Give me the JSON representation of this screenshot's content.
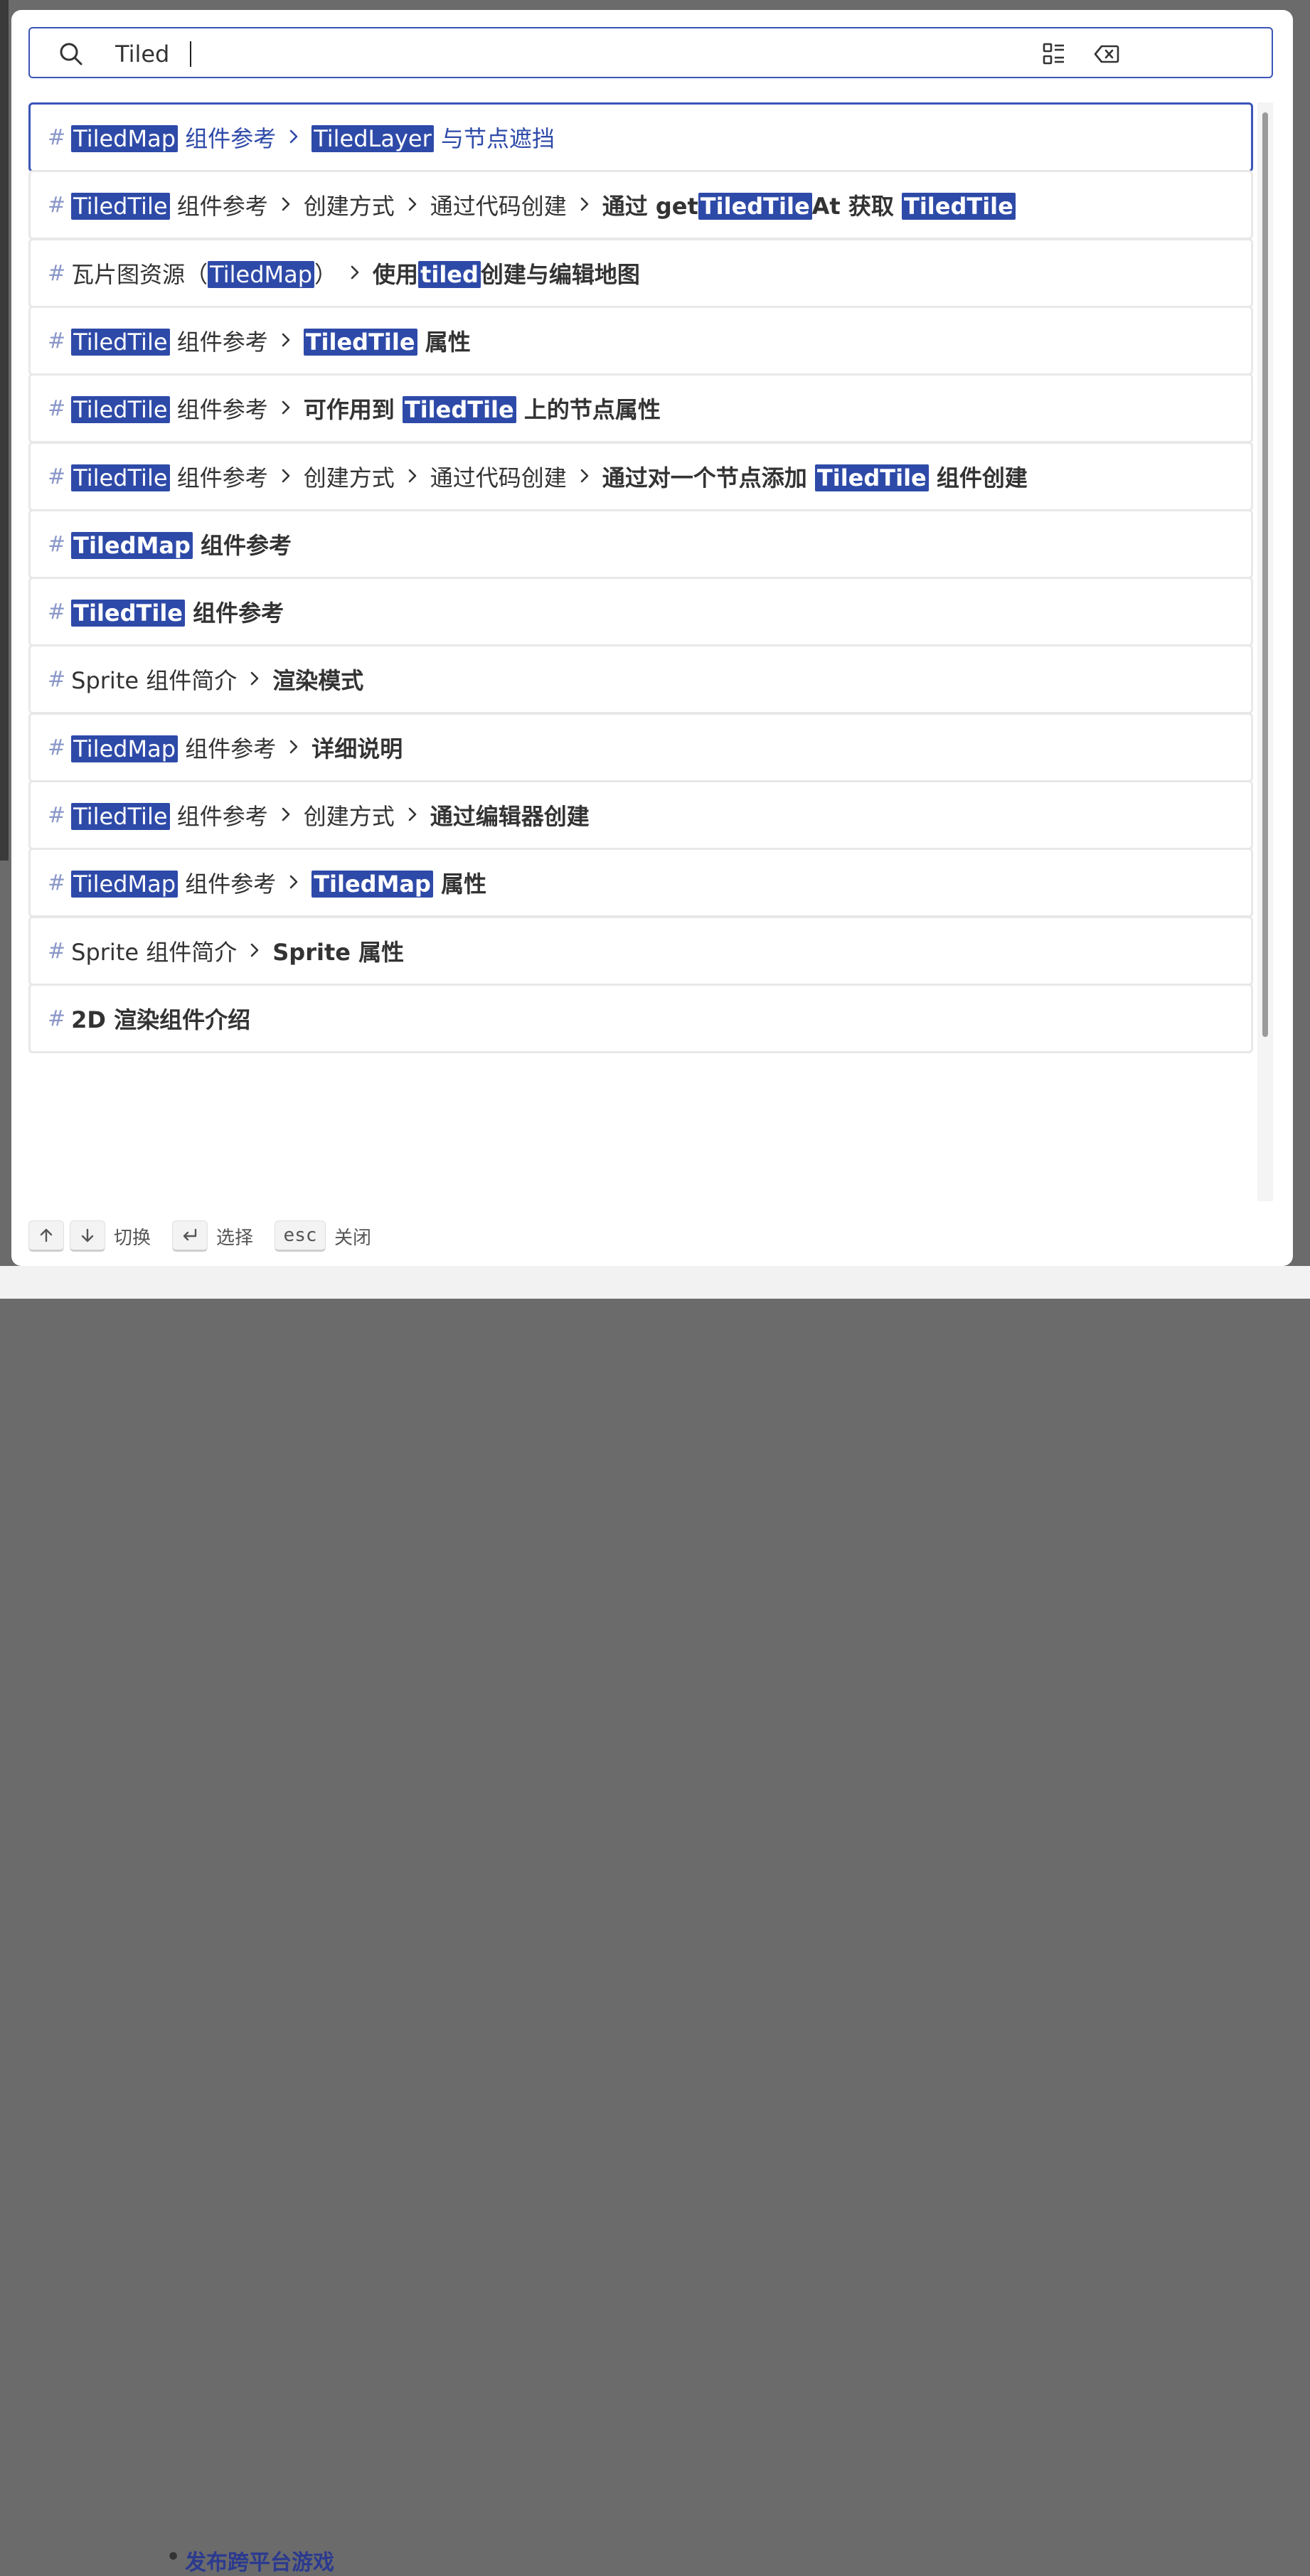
{
  "search": {
    "value": "Tiled",
    "placeholder": ""
  },
  "results": [
    {
      "parts": [
        {
          "segments": [
            {
              "t": "TiledMap",
              "hl": true
            },
            {
              "t": " 组件参考"
            }
          ]
        },
        {
          "segments": [
            {
              "t": "TiledLayer",
              "hl": true
            },
            {
              "t": " 与节点遮挡"
            }
          ]
        }
      ],
      "active": true
    },
    {
      "parts": [
        {
          "segments": [
            {
              "t": "TiledTile",
              "hl": true
            },
            {
              "t": " 组件参考"
            }
          ]
        },
        {
          "segments": [
            {
              "t": "创建方式"
            }
          ]
        },
        {
          "segments": [
            {
              "t": "通过代码创建"
            }
          ]
        },
        {
          "segments": [
            {
              "t": "通过 get"
            },
            {
              "t": "TiledTile",
              "hl": true
            },
            {
              "t": "At 获取 "
            },
            {
              "t": "TiledTile",
              "hl": true
            }
          ]
        }
      ]
    },
    {
      "parts": [
        {
          "segments": [
            {
              "t": "瓦片图资源（"
            },
            {
              "t": "TiledMap",
              "hl": true
            },
            {
              "t": "）"
            }
          ]
        },
        {
          "segments": [
            {
              "t": "使用"
            },
            {
              "t": "tiled",
              "hl": true
            },
            {
              "t": "创建与编辑地图"
            }
          ]
        }
      ]
    },
    {
      "parts": [
        {
          "segments": [
            {
              "t": "TiledTile",
              "hl": true
            },
            {
              "t": " 组件参考"
            }
          ]
        },
        {
          "segments": [
            {
              "t": "TiledTile",
              "hl": true
            },
            {
              "t": " 属性"
            }
          ]
        }
      ]
    },
    {
      "parts": [
        {
          "segments": [
            {
              "t": "TiledTile",
              "hl": true
            },
            {
              "t": " 组件参考"
            }
          ]
        },
        {
          "segments": [
            {
              "t": "可作用到 "
            },
            {
              "t": "TiledTile",
              "hl": true
            },
            {
              "t": " 上的节点属性"
            }
          ]
        }
      ]
    },
    {
      "parts": [
        {
          "segments": [
            {
              "t": "TiledTile",
              "hl": true
            },
            {
              "t": " 组件参考"
            }
          ]
        },
        {
          "segments": [
            {
              "t": "创建方式"
            }
          ]
        },
        {
          "segments": [
            {
              "t": "通过代码创建"
            }
          ]
        },
        {
          "segments": [
            {
              "t": "通过对一个节点添加 "
            },
            {
              "t": "TiledTile",
              "hl": true
            },
            {
              "t": " 组件创建"
            }
          ]
        }
      ]
    },
    {
      "parts": [
        {
          "segments": [
            {
              "t": "TiledMap",
              "hl": true
            },
            {
              "t": " 组件参考"
            }
          ]
        }
      ]
    },
    {
      "parts": [
        {
          "segments": [
            {
              "t": "TiledTile",
              "hl": true
            },
            {
              "t": " 组件参考"
            }
          ]
        }
      ]
    },
    {
      "parts": [
        {
          "segments": [
            {
              "t": "Sprite 组件简介"
            }
          ]
        },
        {
          "segments": [
            {
              "t": "渲染模式"
            }
          ]
        }
      ]
    },
    {
      "parts": [
        {
          "segments": [
            {
              "t": "TiledMap",
              "hl": true
            },
            {
              "t": " 组件参考"
            }
          ]
        },
        {
          "segments": [
            {
              "t": "详细说明"
            }
          ]
        }
      ]
    },
    {
      "parts": [
        {
          "segments": [
            {
              "t": "TiledTile",
              "hl": true
            },
            {
              "t": " 组件参考"
            }
          ]
        },
        {
          "segments": [
            {
              "t": "创建方式"
            }
          ]
        },
        {
          "segments": [
            {
              "t": "通过编辑器创建"
            }
          ]
        }
      ]
    },
    {
      "parts": [
        {
          "segments": [
            {
              "t": "TiledMap",
              "hl": true
            },
            {
              "t": " 组件参考"
            }
          ]
        },
        {
          "segments": [
            {
              "t": "TiledMap",
              "hl": true
            },
            {
              "t": " 属性"
            }
          ]
        }
      ]
    },
    {
      "parts": [
        {
          "segments": [
            {
              "t": "Sprite 组件简介"
            }
          ]
        },
        {
          "segments": [
            {
              "t": "Sprite 属性"
            }
          ]
        }
      ]
    },
    {
      "parts": [
        {
          "segments": [
            {
              "t": "2D 渲染组件介绍"
            }
          ]
        }
      ]
    }
  ],
  "hash_symbol": "#",
  "footer": {
    "navigate_label": "切换",
    "select_label": "选择",
    "esc_key": "esc",
    "close_label": "关闭"
  },
  "backdrop": {
    "link_text": "发布跨平台游戏"
  },
  "colors": {
    "accent": "#2e4aa8",
    "border_active": "#3b55b8",
    "item_border": "#e8e8e8"
  }
}
